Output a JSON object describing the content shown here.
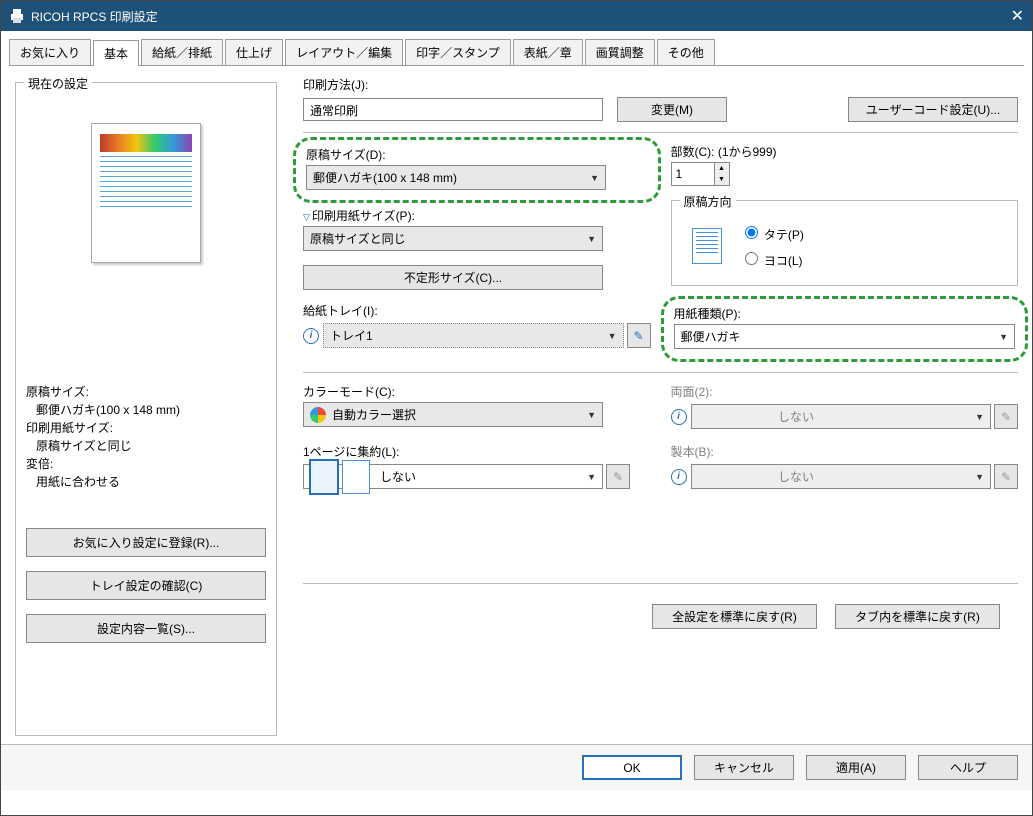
{
  "title": "RICOH              RPCS 印刷設定",
  "tabs": [
    "お気に入り",
    "基本",
    "給紙／排紙",
    "仕上げ",
    "レイアウト／編集",
    "印字／スタンプ",
    "表紙／章",
    "画質調整",
    "その他"
  ],
  "activeTab": "基本",
  "currentSettings": {
    "legend": "現在の設定",
    "lines": {
      "docSizeLabel": "原稿サイズ:",
      "docSizeValue": "郵便ハガキ(100 x 148 mm)",
      "printSizeLabel": "印刷用紙サイズ:",
      "printSizeValue": "原稿サイズと同じ",
      "zoomLabel": "変倍:",
      "zoomValue": "用紙に合わせる"
    },
    "buttons": {
      "registerFav": "お気に入り設定に登録(R)...",
      "trayConfirm": "トレイ設定の確認(C)",
      "settingsList": "設定内容一覧(S)..."
    }
  },
  "printMethod": {
    "label": "印刷方法(J):",
    "value": "通常印刷",
    "changeBtn": "変更(M)",
    "userCodeBtn": "ユーザーコード設定(U)..."
  },
  "docSize": {
    "label": "原稿サイズ(D):",
    "value": "郵便ハガキ(100 x 148 mm)"
  },
  "printPaperSize": {
    "label": "印刷用紙サイズ(P):",
    "value": "原稿サイズと同じ"
  },
  "irregularSizeBtn": "不定形サイズ(C)...",
  "copies": {
    "label": "部数(C): (1から999)",
    "value": "1"
  },
  "orientation": {
    "legend": "原稿方向",
    "portrait": "タテ(P)",
    "landscape": "ヨコ(L)"
  },
  "tray": {
    "label": "給紙トレイ(I):",
    "value": "トレイ1"
  },
  "paperType": {
    "label": "用紙種類(P):",
    "value": "郵便ハガキ"
  },
  "colorMode": {
    "label": "カラーモード(C):",
    "value": "自動カラー選択"
  },
  "duplex": {
    "label": "両面(2):",
    "value": "しない"
  },
  "nup": {
    "label": "1ページに集約(L):",
    "value": "しない"
  },
  "booklet": {
    "label": "製本(B):",
    "value": "しない"
  },
  "resetAllBtn": "全設定を標準に戻す(R)",
  "resetTabBtn": "タブ内を標準に戻す(R)",
  "dialog": {
    "ok": "OK",
    "cancel": "キャンセル",
    "apply": "適用(A)",
    "help": "ヘルプ"
  }
}
